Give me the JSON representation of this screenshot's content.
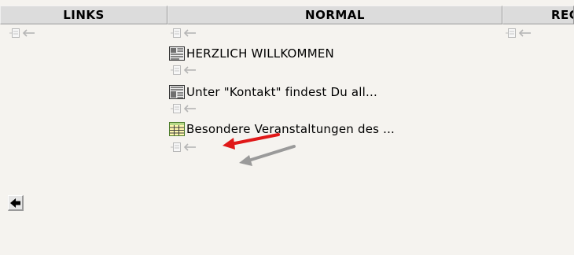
{
  "columns": {
    "links": "LINKS",
    "normal": "NORMAL",
    "rechts": "REC"
  },
  "content_elements": [
    {
      "label": "HERZLICH WILLKOMMEN",
      "icon": "text-with-image-icon"
    },
    {
      "label": "Unter \"Kontakt\" findest Du all...",
      "icon": "text-with-image-icon"
    },
    {
      "label": "Besondere Veranstaltungen des ...",
      "icon": "table-icon"
    }
  ],
  "icons": {
    "insert_control": "new-record-arrow-icon",
    "back": "back-arrow-icon"
  },
  "annotations": {
    "primary_arrow_color": "#e01818",
    "secondary_arrow_color": "#9a9a9a"
  },
  "colors": {
    "background": "#f5f3ef",
    "header_background": "#dcdcdc"
  }
}
